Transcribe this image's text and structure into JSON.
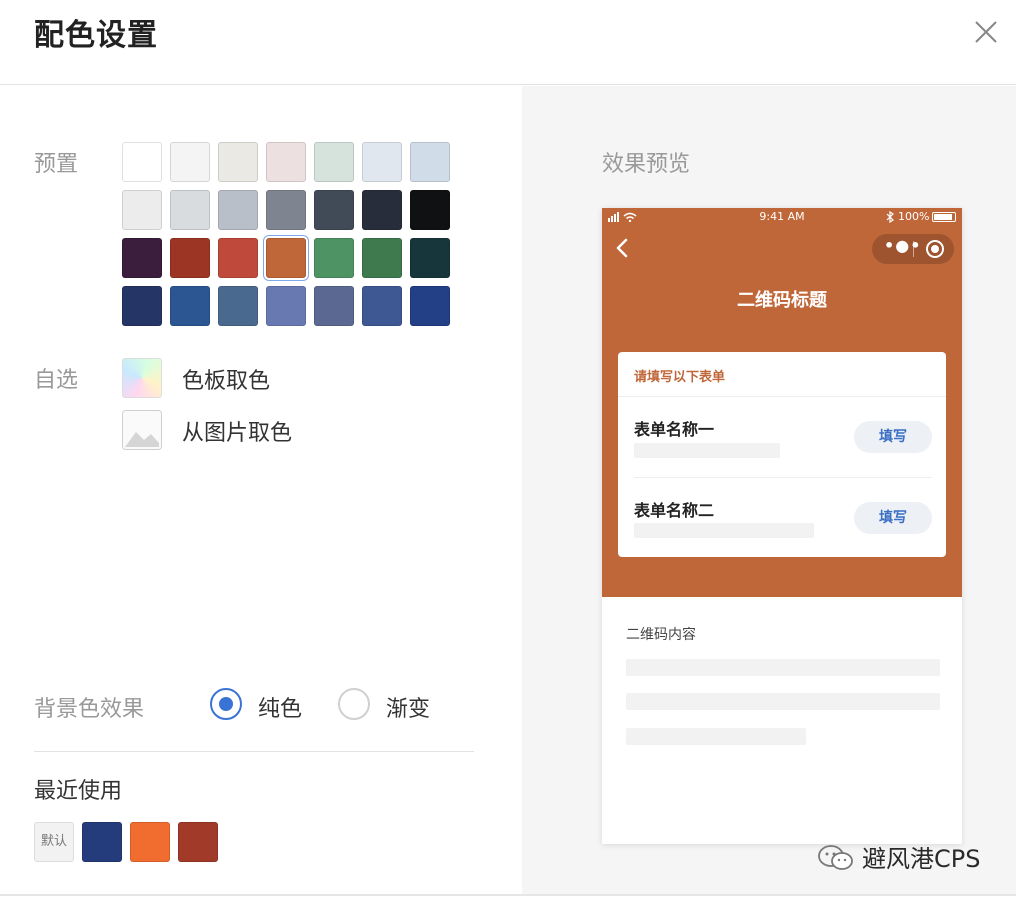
{
  "dialog": {
    "title": "配色设置"
  },
  "presets": {
    "label": "预置",
    "rows": [
      [
        "#ffffff",
        "#f4f4f4",
        "#ebe9e4",
        "#ede0e0",
        "#d6e3dc",
        "#e0e7ef",
        "#d1dce9"
      ],
      [
        "#ececec",
        "#d9dcdf",
        "#b9bfc8",
        "#7f8590",
        "#414a57",
        "#272d3a",
        "#0f1113"
      ],
      [
        "#3b1d3e",
        "#9d3524",
        "#bf4a3c",
        "#c0673a",
        "#4e9363",
        "#3f7a4e",
        "#17363c"
      ],
      [
        "#253565",
        "#2b5692",
        "#4a698f",
        "#6878b1",
        "#5b6992",
        "#3e5894",
        "#233f85"
      ]
    ],
    "selected": "#c0673a"
  },
  "custom": {
    "label": "自选",
    "palette_label": "色板取色",
    "image_label": "从图片取色"
  },
  "background": {
    "label": "背景色效果",
    "options": [
      "纯色",
      "渐变"
    ],
    "selected": "纯色"
  },
  "recent": {
    "label": "最近使用",
    "default_label": "默认",
    "colors": [
      "#253c7c",
      "#f06c2f",
      "#a13a28"
    ]
  },
  "preview": {
    "label": "效果预览",
    "theme_color": "#c0673a",
    "status_time": "9:41 AM",
    "status_battery": "100%",
    "qr_title": "二维码标题",
    "form_heading": "请填写以下表单",
    "forms": [
      {
        "name": "表单名称一",
        "button": "填写"
      },
      {
        "name": "表单名称二",
        "button": "填写"
      }
    ],
    "content_label": "二维码内容"
  },
  "watermark": {
    "text": "避风港CPS"
  },
  "colors": {
    "accent": "#3a73d6",
    "radio_border": "#d0d0d0"
  },
  "icons": [
    "close-icon",
    "palette-gradient-icon",
    "image-icon",
    "back-chevron-icon",
    "more-dots-icon",
    "target-icon",
    "wechat-icon",
    "battery-icon",
    "wifi-icon",
    "signal-icon",
    "bluetooth-icon"
  ]
}
